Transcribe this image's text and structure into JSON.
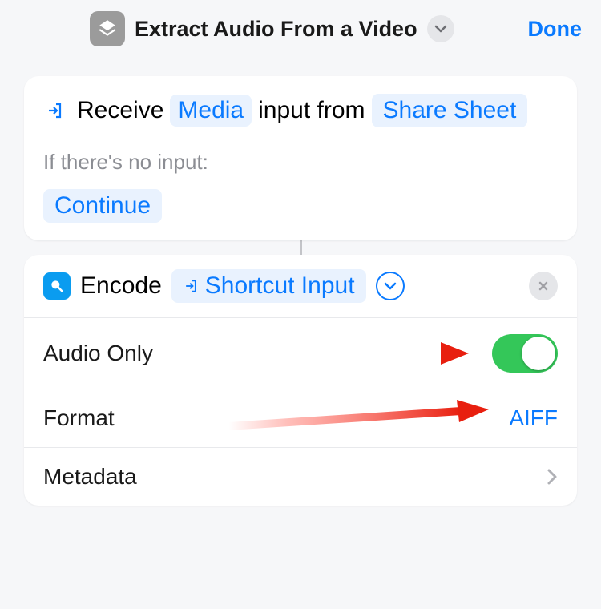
{
  "header": {
    "title": "Extract Audio From a Video",
    "done": "Done"
  },
  "inputCard": {
    "receive": "Receive",
    "media": "Media",
    "inputFrom": "input from",
    "shareSheet": "Share Sheet",
    "noInputLabel": "If there's no input:",
    "continue": "Continue"
  },
  "encodeCard": {
    "title": "Encode",
    "shortcutInput": "Shortcut Input",
    "rows": {
      "audioOnly": {
        "label": "Audio Only",
        "on": true
      },
      "format": {
        "label": "Format",
        "value": "AIFF"
      },
      "metadata": {
        "label": "Metadata"
      }
    }
  }
}
